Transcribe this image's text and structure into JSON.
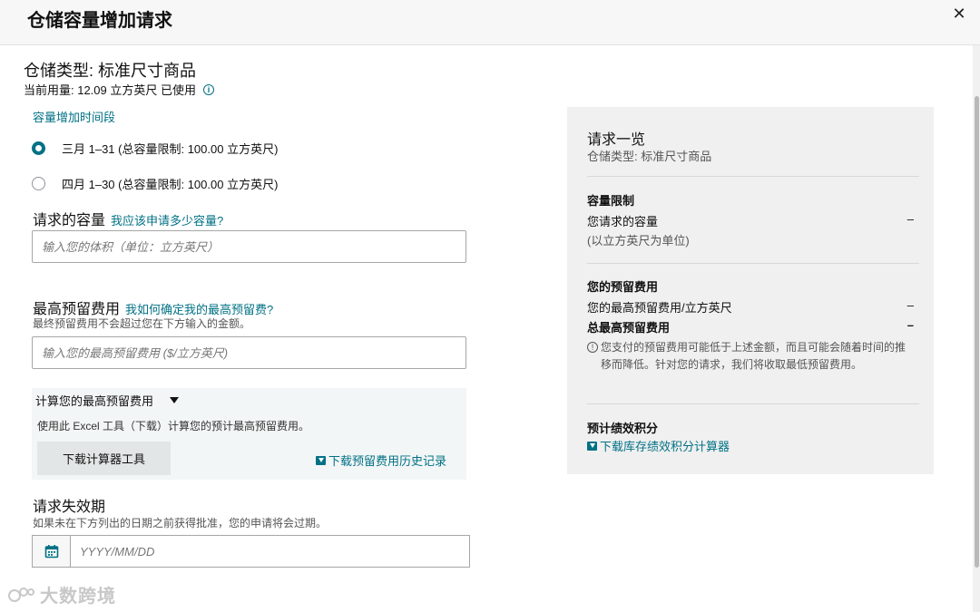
{
  "modal": {
    "title": "仓储容量增加请求",
    "close_glyph": "✕"
  },
  "header": {
    "storage_type": "仓储类型: 标准尺寸商品",
    "current_usage": "当前用量: 12.09 立方英尺 已使用",
    "info_glyph": "i"
  },
  "period": {
    "label": "容量增加时间段",
    "options": [
      {
        "label": "三月 1–31 (总容量限制: 100.00 立方英尺)",
        "selected": true
      },
      {
        "label": "四月 1–30 (总容量限制: 100.00 立方英尺)",
        "selected": false
      }
    ]
  },
  "requested": {
    "title": "请求的容量",
    "help_link": "我应该申请多少容量?",
    "placeholder": "输入您的体积（单位：立方英尺）"
  },
  "reserve_fee": {
    "title": "最高预留费用",
    "help_link": "我如何确定我的最高预留费?",
    "hint": "最终预留费用不会超过您在下方输入的金额。",
    "placeholder": "输入您的最高预留费用 ($/立方英尺)"
  },
  "calculator": {
    "title": "计算您的最高预留费用",
    "description": "使用此 Excel 工具（下载）计算您的预计最高预留费用。",
    "download_button": "下载计算器工具",
    "history_link": "下载预留费用历史记录"
  },
  "expiry": {
    "title": "请求失效期",
    "hint": "如果未在下方列出的日期之前获得批准，您的申请将会过期。",
    "placeholder": "YYYY/MM/DD"
  },
  "watermark": {
    "text": "大数跨境"
  },
  "summary": {
    "title": "请求一览",
    "subtitle": "仓储类型: 标准尺寸商品",
    "capacity": {
      "heading": "容量限制",
      "row_label": "您请求的容量",
      "row_value": "–",
      "unit_note": "(以立方英尺为单位)"
    },
    "fee": {
      "heading": "您的预留费用",
      "rows": [
        {
          "label": "您的最高预留费用/立方英尺",
          "value": "–"
        },
        {
          "label": "总最高预留费用",
          "value": "–"
        }
      ],
      "note": "您支付的预留费用可能低于上述金额，而且可能会随着时间的推移而降低。针对您的请求，我们将收取最低预留费用。",
      "note_glyph": "!"
    },
    "credits": {
      "heading": "预计绩效积分",
      "link": "下载库存绩效积分计算器"
    }
  },
  "colors": {
    "accent": "#007185",
    "panel": "#f0f0f0",
    "header_bg": "#f7f7f7"
  },
  "icons": [
    "close-icon",
    "info-icon",
    "triangle-down-icon",
    "download-icon",
    "calendar-icon",
    "warning-icon"
  ]
}
